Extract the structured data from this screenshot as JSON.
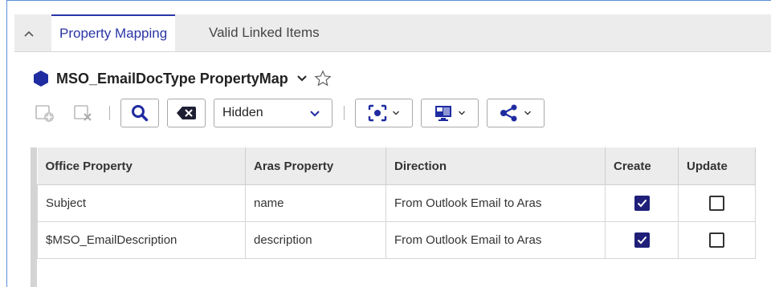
{
  "tabs": {
    "collapse_icon": "chevron-up-icon",
    "items": [
      {
        "label": "Property Mapping",
        "active": true
      },
      {
        "label": "Valid Linked Items",
        "active": false
      }
    ],
    "accent": "#2a35a6"
  },
  "header": {
    "title": "MSO_EmailDocType PropertyMap",
    "item_icon": "hexagon-icon",
    "item_icon_color": "#1f2ba0"
  },
  "toolbar": {
    "add_icon": "add-row-icon",
    "delete_icon": "delete-row-icon",
    "search_icon": "search-icon",
    "clear_icon": "clear-search-icon",
    "view_select": {
      "value": "Hidden"
    },
    "focus_icon": "focus-mode-icon",
    "layout_icon": "layout-icon",
    "share_icon": "share-icon"
  },
  "grid": {
    "columns": [
      "Office Property",
      "Aras Property",
      "Direction",
      "Create",
      "Update"
    ],
    "rows": [
      {
        "office_property": "Subject",
        "aras_property": "name",
        "direction": "From Outlook Email to Aras",
        "create": true,
        "update": false
      },
      {
        "office_property": "$MSO_EmailDescription",
        "aras_property": "description",
        "direction": "From Outlook Email to Aras",
        "create": true,
        "update": false
      }
    ]
  }
}
